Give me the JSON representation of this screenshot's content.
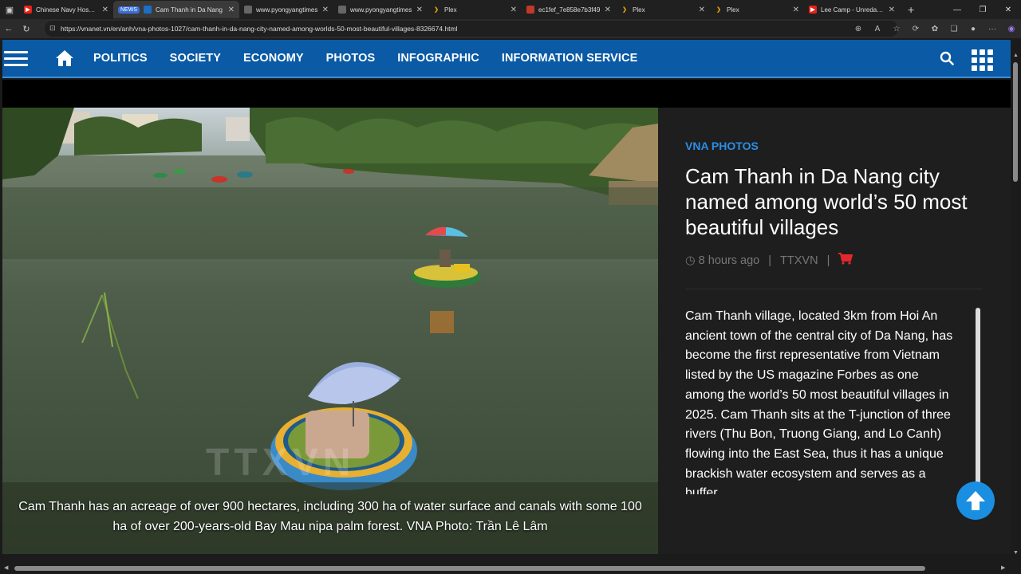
{
  "browser": {
    "tabs": [
      {
        "title": "Chinese Navy Hospital",
        "icon": "youtube-icon",
        "color": "#e62117"
      },
      {
        "badge": "NEWS",
        "title": "Cam Thanh in Da Nang",
        "icon": "vnanet-icon",
        "color": "#1b6fc4",
        "active": true
      },
      {
        "title": "www.pyongyangtimes",
        "icon": "globe-icon",
        "color": "#666666"
      },
      {
        "title": "www.pyongyangtimes",
        "icon": "globe-icon",
        "color": "#666666"
      },
      {
        "title": "Plex",
        "icon": "plex-icon",
        "color": "#e5a00d"
      },
      {
        "title": "ec1fef_7e858e7b3f49",
        "icon": "image-icon",
        "color": "#c0392b"
      },
      {
        "title": "Plex",
        "icon": "plex-icon",
        "color": "#e5a00d"
      },
      {
        "title": "Plex",
        "icon": "plex-icon",
        "color": "#e5a00d"
      },
      {
        "title": "Lee Camp - Unredacted",
        "icon": "youtube-icon",
        "color": "#e62117"
      }
    ],
    "url": "https://vnanet.vn/en/anh/vna-photos-1027/cam-thanh-in-da-nang-city-named-among-worlds-50-most-beautiful-villages-8326674.html"
  },
  "nav": {
    "links": [
      "POLITICS",
      "SOCIETY",
      "ECONOMY",
      "PHOTOS",
      "INFOGRAPHIC",
      "INFORMATION SERVICE"
    ]
  },
  "photo": {
    "caption": "Cam Thanh has an acreage of over 900 hectares, including 300 ha of water surface and canals with some 100 ha of over 200-years-old Bay Mau nipa palm forest. VNA Photo: Trần Lê Lâm",
    "watermark": "TTXVN"
  },
  "article": {
    "kicker": "VNA PHOTOS",
    "title": "Cam Thanh in Da Nang city named among world’s 50 most beautiful villages",
    "time": "8 hours ago",
    "source": "TTXVN",
    "body": "Cam Thanh village, located 3km from Hoi An ancient town of the central city of Da Nang, has become the first representative from Vietnam listed by the US magazine Forbes as one among the world’s 50 most beautiful villages in 2025. Cam Thanh sits at the T-junction of three rivers (Thu Bon, Truong Giang, and Lo Canh) flowing into the East Sea, thus it has a unique brackish water ecosystem and serves as a buffer"
  },
  "colors": {
    "nav_bg": "#0a5aa5",
    "accent": "#2a8ee8",
    "cart": "#e0282e",
    "back_to_top": "#1a8ee0"
  }
}
